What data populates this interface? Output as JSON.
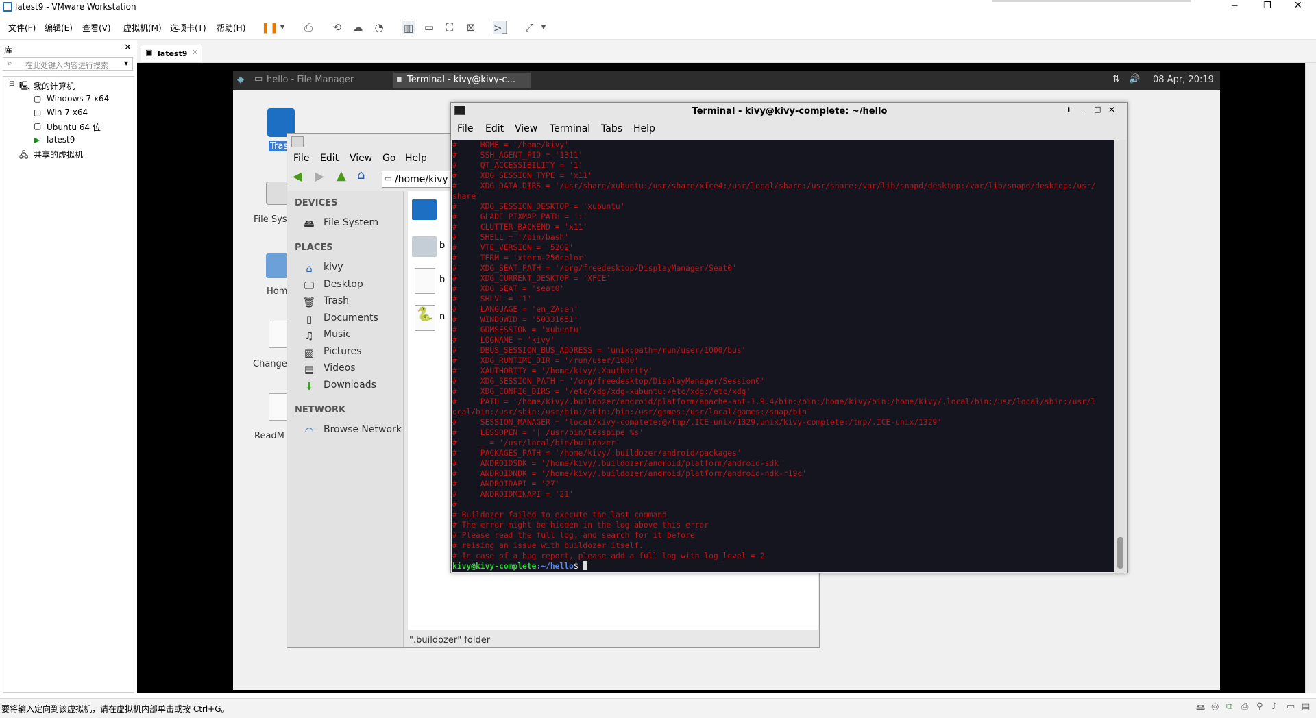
{
  "vmware": {
    "title": "latest9 - VMware Workstation",
    "menus": [
      "文件(F)",
      "编辑(E)",
      "查看(V)",
      "虚拟机(M)",
      "选项卡(T)",
      "帮助(H)"
    ],
    "library_title": "库",
    "search_placeholder": "在此处键入内容进行搜索",
    "tree": {
      "my_computer": "我的计算机",
      "vms": [
        "Windows 7 x64",
        "Win 7 x64",
        "Ubuntu 64 位",
        "latest9"
      ],
      "shared": "共享的虚拟机"
    },
    "tab": "latest9",
    "status": "要将输入定向到该虚拟机，请在虚拟机内部单击或按 Ctrl+G。"
  },
  "guest": {
    "panel": {
      "tasks": [
        "hello - File Manager",
        "Terminal - kivy@kivy-c..."
      ],
      "clock": "08 Apr, 20:19"
    },
    "desktop_icons": [
      "Tras",
      "File Sys",
      "Hom",
      "Change",
      "ReadM"
    ],
    "file_manager": {
      "menus": [
        "File",
        "Edit",
        "View",
        "Go",
        "Help"
      ],
      "path": "/home/kivy",
      "sections": {
        "devices": "DEVICES",
        "places": "PLACES",
        "network": "NETWORK"
      },
      "devices": [
        {
          "label": "File System",
          "icon": "drive-icon"
        }
      ],
      "places": [
        {
          "label": "kivy",
          "icon": "home-icon"
        },
        {
          "label": "Desktop",
          "icon": "desktop-icon"
        },
        {
          "label": "Trash",
          "icon": "trash-icon"
        },
        {
          "label": "Documents",
          "icon": "document-icon"
        },
        {
          "label": "Music",
          "icon": "music-icon"
        },
        {
          "label": "Pictures",
          "icon": "pictures-icon"
        },
        {
          "label": "Videos",
          "icon": "videos-icon"
        },
        {
          "label": "Downloads",
          "icon": "download-icon"
        }
      ],
      "network": [
        {
          "label": "Browse Network",
          "icon": "wifi-icon"
        }
      ],
      "files": [
        "",
        "b",
        "b",
        "n"
      ],
      "status": "\".buildozer\" folder"
    },
    "terminal": {
      "title": "Terminal - kivy@kivy-complete: ~/hello",
      "menus": [
        "File",
        "Edit",
        "View",
        "Terminal",
        "Tabs",
        "Help"
      ],
      "lines": [
        "#     HOME = '/home/kivy'",
        "#     SSH_AGENT_PID = '1311'",
        "#     QT_ACCESSIBILITY = '1'",
        "#     XDG_SESSION_TYPE = 'x11'",
        "#     XDG_DATA_DIRS = '/usr/share/xubuntu:/usr/share/xfce4:/usr/local/share:/usr/share:/var/lib/snapd/desktop:/var/lib/snapd/desktop:/usr/",
        "share'",
        "#     XDG_SESSION_DESKTOP = 'xubuntu'",
        "#     GLADE_PIXMAP_PATH = ':'",
        "#     CLUTTER_BACKEND = 'x11'",
        "#     SHELL = '/bin/bash'",
        "#     VTE_VERSION = '5202'",
        "#     TERM = 'xterm-256color'",
        "#     XDG_SEAT_PATH = '/org/freedesktop/DisplayManager/Seat0'",
        "#     XDG_CURRENT_DESKTOP = 'XFCE'",
        "#     XDG_SEAT = 'seat0'",
        "#     SHLVL = '1'",
        "#     LANGUAGE = 'en_ZA:en'",
        "#     WINDOWID = '50331651'",
        "#     GDMSESSION = 'xubuntu'",
        "#     LOGNAME = 'kivy'",
        "#     DBUS_SESSION_BUS_ADDRESS = 'unix:path=/run/user/1000/bus'",
        "#     XDG_RUNTIME_DIR = '/run/user/1000'",
        "#     XAUTHORITY = '/home/kivy/.Xauthority'",
        "#     XDG_SESSION_PATH = '/org/freedesktop/DisplayManager/Session0'",
        "#     XDG_CONFIG_DIRS = '/etc/xdg/xdg-xubuntu:/etc/xdg:/etc/xdg'",
        "#     PATH = '/home/kivy/.buildozer/android/platform/apache-ant-1.9.4/bin:/bin:/home/kivy/bin:/home/kivy/.local/bin:/usr/local/sbin:/usr/l",
        "ocal/bin:/usr/sbin:/usr/bin:/sbin:/bin:/usr/games:/usr/local/games:/snap/bin'",
        "#     SESSION_MANAGER = 'local/kivy-complete:@/tmp/.ICE-unix/1329,unix/kivy-complete:/tmp/.ICE-unix/1329'",
        "#     LESSOPEN = '| /usr/bin/lesspipe %s'",
        "#     _ = '/usr/local/bin/buildozer'",
        "#     PACKAGES_PATH = '/home/kivy/.buildozer/android/packages'",
        "#     ANDROIDSDK = '/home/kivy/.buildozer/android/platform/android-sdk'",
        "#     ANDROIDNDK = '/home/kivy/.buildozer/android/platform/android-ndk-r19c'",
        "#     ANDROIDAPI = '27'",
        "#     ANDROIDMINAPI = '21'",
        "#",
        "# Buildozer failed to execute the last command",
        "# The error might be hidden in the log above this error",
        "# Please read the full log, and search for it before",
        "# raising an issue with buildozer itself.",
        "# In case of a bug report, please add a full log with log_level = 2"
      ],
      "prompt_user": "kivy@kivy-complete",
      "prompt_path": ":~/hello",
      "prompt_end": "$ "
    }
  }
}
